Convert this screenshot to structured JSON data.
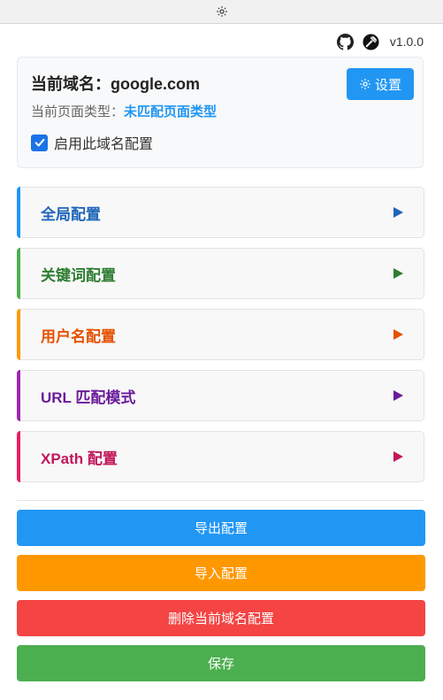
{
  "header": {
    "version": "v1.0.0",
    "icons": [
      "github-icon",
      "greasyfork-icon"
    ]
  },
  "domain_card": {
    "domain_label": "当前域名：",
    "domain_value": "google.com",
    "page_type_label": "当前页面类型：",
    "page_type_value": "未匹配页面类型",
    "enable_label": "启用此域名配置",
    "enable_checked": true,
    "settings_label": "设置"
  },
  "sections": [
    {
      "label": "全局配置",
      "color": "#1f66b9",
      "bar": "#2196f3"
    },
    {
      "label": "关键词配置",
      "color": "#2e7d32",
      "bar": "#4caf50"
    },
    {
      "label": "用户名配置",
      "color": "#e65100",
      "bar": "#ff9800"
    },
    {
      "label": "URL 匹配模式",
      "color": "#6a1b9a",
      "bar": "#9c27b0"
    },
    {
      "label": "XPath 配置",
      "color": "#c2185b",
      "bar": "#e91e63"
    }
  ],
  "actions": [
    {
      "label": "导出配置",
      "color": "#2196f3"
    },
    {
      "label": "导入配置",
      "color": "#ff9800"
    },
    {
      "label": "删除当前域名配置",
      "color": "#f44444"
    },
    {
      "label": "保存",
      "color": "#4caf50"
    }
  ]
}
